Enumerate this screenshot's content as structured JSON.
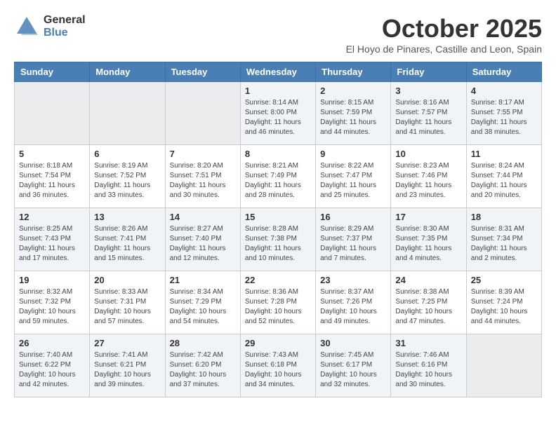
{
  "logo": {
    "general": "General",
    "blue": "Blue"
  },
  "title": "October 2025",
  "location": "El Hoyo de Pinares, Castille and Leon, Spain",
  "weekdays": [
    "Sunday",
    "Monday",
    "Tuesday",
    "Wednesday",
    "Thursday",
    "Friday",
    "Saturday"
  ],
  "weeks": [
    [
      {
        "day": "",
        "info": ""
      },
      {
        "day": "",
        "info": ""
      },
      {
        "day": "",
        "info": ""
      },
      {
        "day": "1",
        "info": "Sunrise: 8:14 AM\nSunset: 8:00 PM\nDaylight: 11 hours\nand 46 minutes."
      },
      {
        "day": "2",
        "info": "Sunrise: 8:15 AM\nSunset: 7:59 PM\nDaylight: 11 hours\nand 44 minutes."
      },
      {
        "day": "3",
        "info": "Sunrise: 8:16 AM\nSunset: 7:57 PM\nDaylight: 11 hours\nand 41 minutes."
      },
      {
        "day": "4",
        "info": "Sunrise: 8:17 AM\nSunset: 7:55 PM\nDaylight: 11 hours\nand 38 minutes."
      }
    ],
    [
      {
        "day": "5",
        "info": "Sunrise: 8:18 AM\nSunset: 7:54 PM\nDaylight: 11 hours\nand 36 minutes."
      },
      {
        "day": "6",
        "info": "Sunrise: 8:19 AM\nSunset: 7:52 PM\nDaylight: 11 hours\nand 33 minutes."
      },
      {
        "day": "7",
        "info": "Sunrise: 8:20 AM\nSunset: 7:51 PM\nDaylight: 11 hours\nand 30 minutes."
      },
      {
        "day": "8",
        "info": "Sunrise: 8:21 AM\nSunset: 7:49 PM\nDaylight: 11 hours\nand 28 minutes."
      },
      {
        "day": "9",
        "info": "Sunrise: 8:22 AM\nSunset: 7:47 PM\nDaylight: 11 hours\nand 25 minutes."
      },
      {
        "day": "10",
        "info": "Sunrise: 8:23 AM\nSunset: 7:46 PM\nDaylight: 11 hours\nand 23 minutes."
      },
      {
        "day": "11",
        "info": "Sunrise: 8:24 AM\nSunset: 7:44 PM\nDaylight: 11 hours\nand 20 minutes."
      }
    ],
    [
      {
        "day": "12",
        "info": "Sunrise: 8:25 AM\nSunset: 7:43 PM\nDaylight: 11 hours\nand 17 minutes."
      },
      {
        "day": "13",
        "info": "Sunrise: 8:26 AM\nSunset: 7:41 PM\nDaylight: 11 hours\nand 15 minutes."
      },
      {
        "day": "14",
        "info": "Sunrise: 8:27 AM\nSunset: 7:40 PM\nDaylight: 11 hours\nand 12 minutes."
      },
      {
        "day": "15",
        "info": "Sunrise: 8:28 AM\nSunset: 7:38 PM\nDaylight: 11 hours\nand 10 minutes."
      },
      {
        "day": "16",
        "info": "Sunrise: 8:29 AM\nSunset: 7:37 PM\nDaylight: 11 hours\nand 7 minutes."
      },
      {
        "day": "17",
        "info": "Sunrise: 8:30 AM\nSunset: 7:35 PM\nDaylight: 11 hours\nand 4 minutes."
      },
      {
        "day": "18",
        "info": "Sunrise: 8:31 AM\nSunset: 7:34 PM\nDaylight: 11 hours\nand 2 minutes."
      }
    ],
    [
      {
        "day": "19",
        "info": "Sunrise: 8:32 AM\nSunset: 7:32 PM\nDaylight: 10 hours\nand 59 minutes."
      },
      {
        "day": "20",
        "info": "Sunrise: 8:33 AM\nSunset: 7:31 PM\nDaylight: 10 hours\nand 57 minutes."
      },
      {
        "day": "21",
        "info": "Sunrise: 8:34 AM\nSunset: 7:29 PM\nDaylight: 10 hours\nand 54 minutes."
      },
      {
        "day": "22",
        "info": "Sunrise: 8:36 AM\nSunset: 7:28 PM\nDaylight: 10 hours\nand 52 minutes."
      },
      {
        "day": "23",
        "info": "Sunrise: 8:37 AM\nSunset: 7:26 PM\nDaylight: 10 hours\nand 49 minutes."
      },
      {
        "day": "24",
        "info": "Sunrise: 8:38 AM\nSunset: 7:25 PM\nDaylight: 10 hours\nand 47 minutes."
      },
      {
        "day": "25",
        "info": "Sunrise: 8:39 AM\nSunset: 7:24 PM\nDaylight: 10 hours\nand 44 minutes."
      }
    ],
    [
      {
        "day": "26",
        "info": "Sunrise: 7:40 AM\nSunset: 6:22 PM\nDaylight: 10 hours\nand 42 minutes."
      },
      {
        "day": "27",
        "info": "Sunrise: 7:41 AM\nSunset: 6:21 PM\nDaylight: 10 hours\nand 39 minutes."
      },
      {
        "day": "28",
        "info": "Sunrise: 7:42 AM\nSunset: 6:20 PM\nDaylight: 10 hours\nand 37 minutes."
      },
      {
        "day": "29",
        "info": "Sunrise: 7:43 AM\nSunset: 6:18 PM\nDaylight: 10 hours\nand 34 minutes."
      },
      {
        "day": "30",
        "info": "Sunrise: 7:45 AM\nSunset: 6:17 PM\nDaylight: 10 hours\nand 32 minutes."
      },
      {
        "day": "31",
        "info": "Sunrise: 7:46 AM\nSunset: 6:16 PM\nDaylight: 10 hours\nand 30 minutes."
      },
      {
        "day": "",
        "info": ""
      }
    ]
  ]
}
